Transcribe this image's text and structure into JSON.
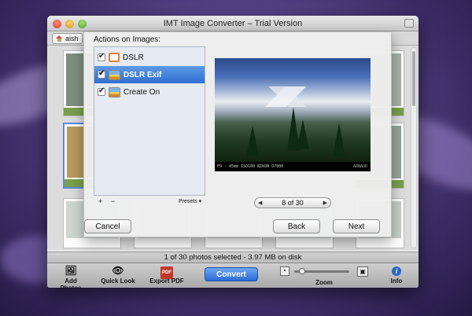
{
  "window": {
    "title": "IMT Image Converter – Trial Version"
  },
  "toolbar": {
    "home_label": "aish"
  },
  "sheet": {
    "heading": "Actions on Images:",
    "actions": [
      {
        "label": "DSLR",
        "icon": "orange-frame-icon",
        "checked": true,
        "selected": false
      },
      {
        "label": "DSLR Exif",
        "icon": "landscape-icon",
        "checked": true,
        "selected": true
      },
      {
        "label": "Create On",
        "icon": "landscape-icon",
        "checked": true,
        "selected": false
      }
    ],
    "add_symbol": "+",
    "remove_symbol": "−",
    "presets_label": "Presets ▾",
    "preview_caption": "F9 · 45mm ISO100 NIKON D7000",
    "preview_brand": "ARNAUD",
    "pager": {
      "text": "8 of 30",
      "prev": "◀",
      "next": "▶"
    },
    "cancel_label": "Cancel",
    "back_label": "Back",
    "next_label": "Next"
  },
  "status": {
    "text": "1 of 30 photos selected - 3.97 MB on disk"
  },
  "bottom": {
    "add_photos": "Add Photos",
    "quick_look": "Quick Look",
    "export_pdf": "Export PDF",
    "pdf_badge": "PDF",
    "convert": "Convert",
    "zoom": "Zoom",
    "zoom_level": 0.1,
    "info": "Info",
    "info_badge": "i"
  },
  "colors": {
    "accent": "#2b6bd6",
    "selection": "#3a7ad8",
    "thumb_green": "#7aa04c"
  }
}
